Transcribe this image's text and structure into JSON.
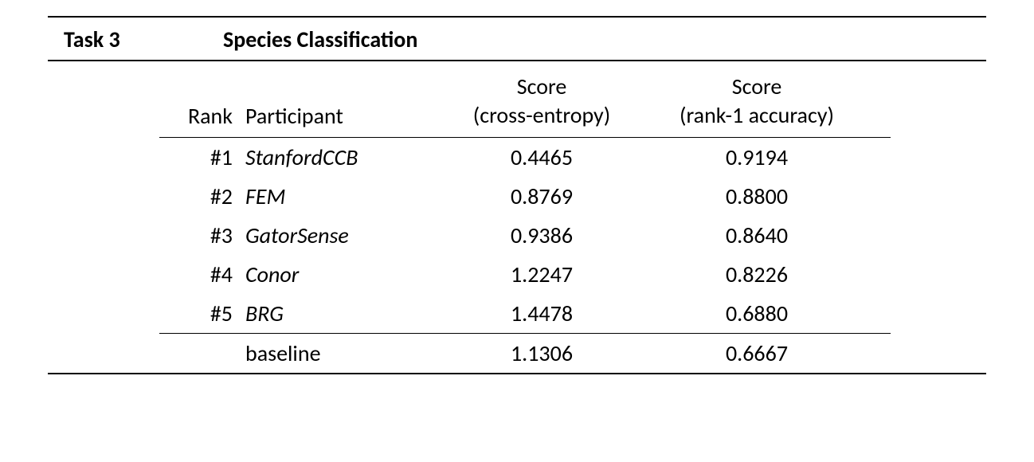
{
  "task": {
    "label": "Task 3",
    "title": "Species Classification"
  },
  "headers": {
    "rank": "Rank",
    "participant": "Participant",
    "score1_top": "Score",
    "score1_bottom": "(cross-entropy)",
    "score2_top": "Score",
    "score2_bottom": "(rank-1 accuracy)"
  },
  "rows": [
    {
      "rank": "#1",
      "participant": "StanfordCCB",
      "score1": "0.4465",
      "score2": "0.9194"
    },
    {
      "rank": "#2",
      "participant": "FEM",
      "score1": "0.8769",
      "score2": "0.8800"
    },
    {
      "rank": "#3",
      "participant": "GatorSense",
      "score1": "0.9386",
      "score2": "0.8640"
    },
    {
      "rank": "#4",
      "participant": "Conor",
      "score1": "1.2247",
      "score2": "0.8226"
    },
    {
      "rank": "#5",
      "participant": "BRG",
      "score1": "1.4478",
      "score2": "0.6880"
    }
  ],
  "baseline": {
    "rank": "",
    "participant": "baseline",
    "score1": "1.1306",
    "score2": "0.6667"
  },
  "chart_data": {
    "type": "table",
    "title": "Task 3 Species Classification",
    "columns": [
      "Rank",
      "Participant",
      "Score (cross-entropy)",
      "Score (rank-1 accuracy)"
    ],
    "rows": [
      [
        "#1",
        "StanfordCCB",
        0.4465,
        0.9194
      ],
      [
        "#2",
        "FEM",
        0.8769,
        0.88
      ],
      [
        "#3",
        "GatorSense",
        0.9386,
        0.864
      ],
      [
        "#4",
        "Conor",
        1.2247,
        0.8226
      ],
      [
        "#5",
        "BRG",
        1.4478,
        0.688
      ],
      [
        "",
        "baseline",
        1.1306,
        0.6667
      ]
    ]
  }
}
